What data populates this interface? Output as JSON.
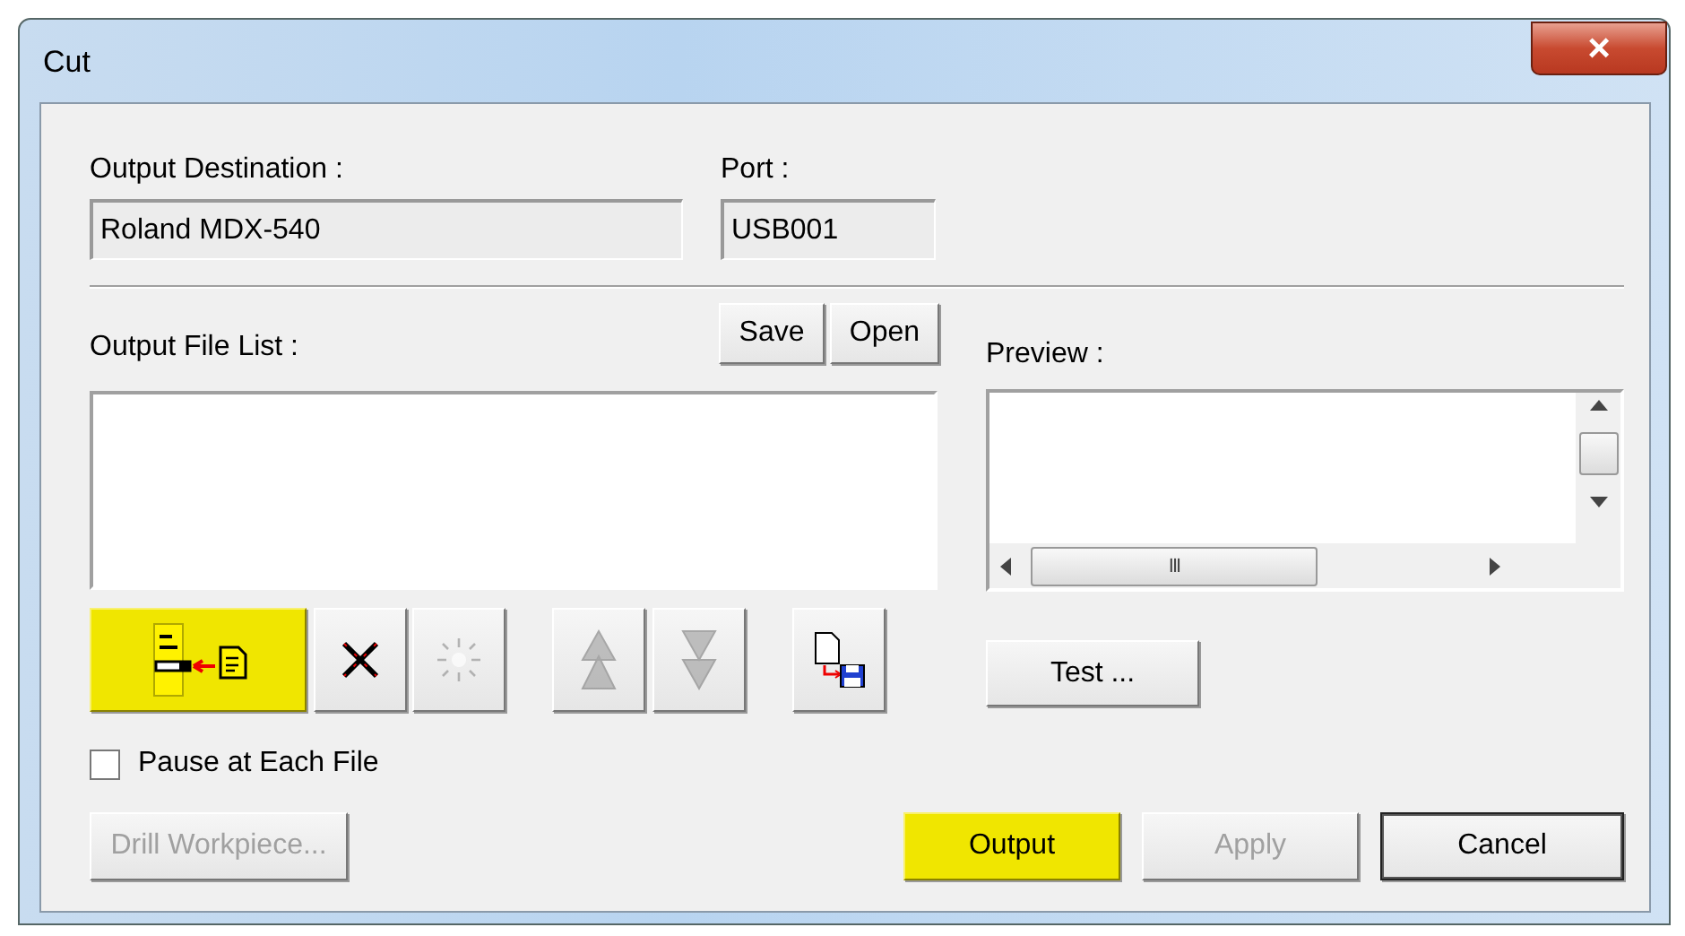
{
  "window": {
    "title": "Cut",
    "close": "×"
  },
  "output_destination": {
    "label": "Output Destination :",
    "value": "Roland MDX-540"
  },
  "port": {
    "label": "Port :",
    "value": "USB001"
  },
  "file_list": {
    "label": "Output File List :",
    "buttons": [
      "Save",
      "Open"
    ]
  },
  "preview": {
    "label": "Preview :",
    "grip": "III"
  },
  "tool_buttons": [
    {
      "kind": "add",
      "disabled": false,
      "highlighted": true
    },
    {
      "kind": "delete",
      "disabled": false,
      "highlighted": false
    },
    {
      "kind": "clear",
      "disabled": true,
      "highlighted": false
    },
    {
      "kind": "up",
      "disabled": true,
      "highlighted": false
    },
    {
      "kind": "down",
      "disabled": true,
      "highlighted": false
    },
    {
      "kind": "export",
      "disabled": false,
      "highlighted": false
    }
  ],
  "test_button": "Test ...",
  "pause_checkbox": {
    "label": "Pause at Each File",
    "checked": false
  },
  "drill_button": {
    "label": "Drill Workpiece...",
    "disabled": true
  },
  "action_buttons": [
    {
      "label": "Output",
      "disabled": false,
      "highlighted": true,
      "default": false
    },
    {
      "label": "Apply",
      "disabled": true,
      "highlighted": false,
      "default": false
    },
    {
      "label": "Cancel",
      "disabled": false,
      "highlighted": false,
      "default": true
    }
  ]
}
